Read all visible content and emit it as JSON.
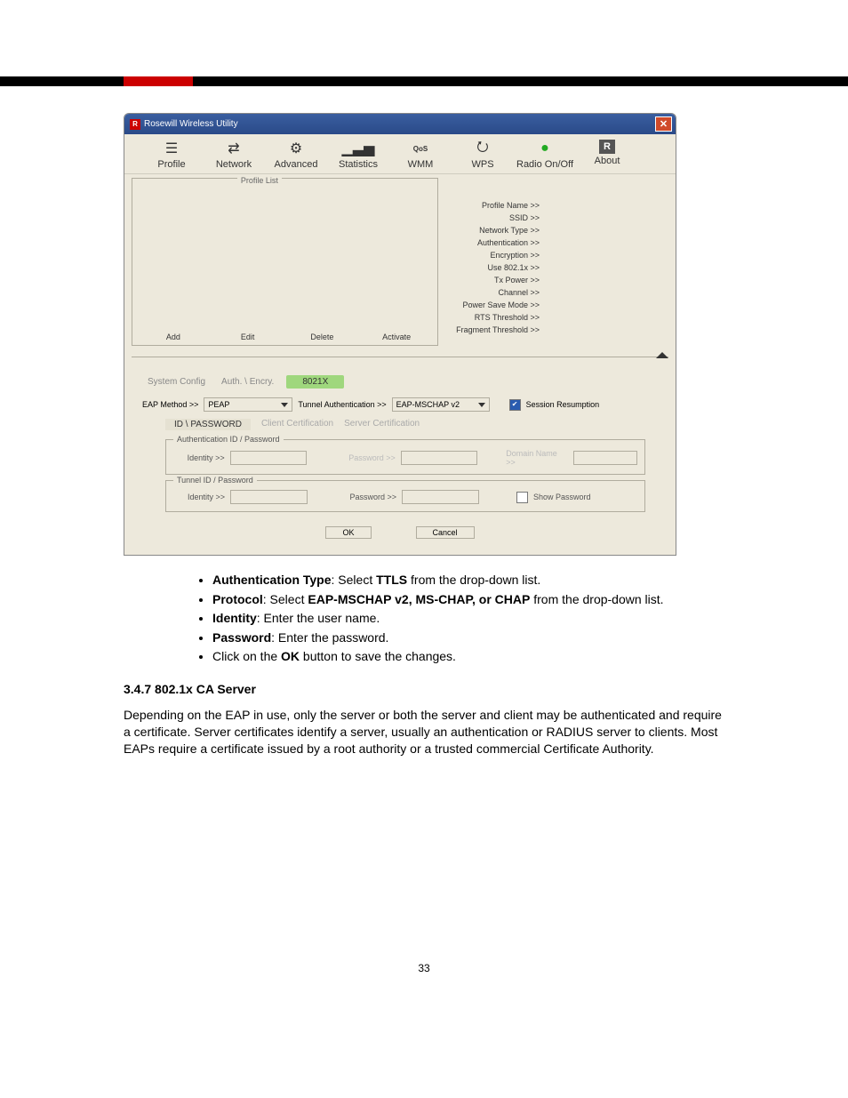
{
  "window": {
    "title": "Rosewill Wireless Utility"
  },
  "toolbar": {
    "items": [
      {
        "label": "Profile",
        "icon": "☰"
      },
      {
        "label": "Network",
        "icon": "⇄"
      },
      {
        "label": "Advanced",
        "icon": "⚙"
      },
      {
        "label": "Statistics",
        "icon": "📶"
      },
      {
        "label": "WMM",
        "icon": "QoS"
      },
      {
        "label": "WPS",
        "icon": "⭮"
      },
      {
        "label": "Radio On/Off",
        "icon": "📡"
      },
      {
        "label": "About",
        "icon": "R"
      }
    ]
  },
  "profile": {
    "legend": "Profile List",
    "buttons": {
      "add": "Add",
      "edit": "Edit",
      "delete": "Delete",
      "activate": "Activate"
    },
    "details": [
      "Profile Name >>",
      "SSID >>",
      "Network Type >>",
      "Authentication >>",
      "Encryption >>",
      "Use 802.1x >>",
      "Tx Power >>",
      "Channel >>",
      "Power Save Mode >>",
      "RTS Threshold >>",
      "Fragment Threshold >>"
    ]
  },
  "tabs": {
    "system": "System Config",
    "auth": "Auth. \\ Encry.",
    "eap": "8021X"
  },
  "eap_row": {
    "eap_method_label": "EAP Method >>",
    "eap_method_value": "PEAP",
    "tunnel_auth_label": "Tunnel Authentication >>",
    "tunnel_auth_value": "EAP-MSCHAP v2",
    "session_label": "Session Resumption"
  },
  "subtabs": {
    "idpw": "ID \\ PASSWORD",
    "client": "Client Certification",
    "server": "Server Certification"
  },
  "group_auth": {
    "legend": "Authentication ID / Password",
    "identity": "Identity >>",
    "password": "Password >>",
    "domain": "Domain Name >>"
  },
  "group_tunnel": {
    "legend": "Tunnel ID / Password",
    "identity": "Identity >>",
    "password": "Password >>",
    "show": "Show Password"
  },
  "buttons": {
    "ok": "OK",
    "cancel": "Cancel"
  },
  "doc": {
    "b1a": "Authentication Type",
    "b1b": ": Select ",
    "b1c": "TTLS",
    "b1d": " from the drop-down list.",
    "b2a": "Protocol",
    "b2b": ": Select ",
    "b2c": "EAP-MSCHAP v2, MS-CHAP, or CHAP",
    "b2d": " from the drop-down list.",
    "b3a": "Identity",
    "b3b": ": Enter the user name.",
    "b4a": "Password",
    "b4b": ": Enter the password.",
    "b5a": "Click on the ",
    "b5b": "OK",
    "b5c": " button to save the changes.",
    "heading": "3.4.7  802.1x CA Server",
    "para": "Depending on the EAP in use, only the server or both the server and client may be authenticated and require a certificate. Server certificates identify a server, usually an authentication or RADIUS server to clients. Most EAPs require a certificate issued by a root authority or a trusted commercial Certificate Authority.",
    "pagenum": "33"
  }
}
